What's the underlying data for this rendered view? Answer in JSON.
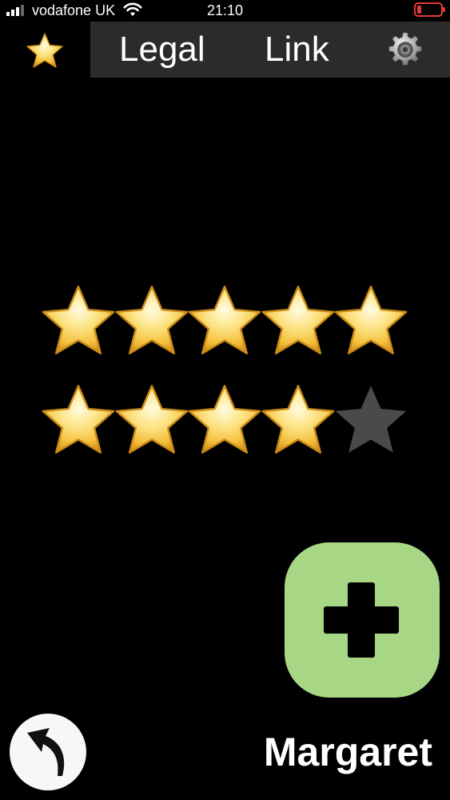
{
  "status_bar": {
    "carrier": "vodafone UK",
    "time": "21:10",
    "signal_bars": 3,
    "signal_bars_total": 4,
    "battery_level": "low",
    "icons": [
      "signal-bars-icon",
      "wifi-icon",
      "battery-icon"
    ],
    "battery_color": "#e53935"
  },
  "header": {
    "app_icon": "star-icon",
    "tabs": [
      {
        "label": "Legal"
      },
      {
        "label": "Link"
      }
    ],
    "settings_icon": "gear-icon",
    "bar_color": "#2b2b2b"
  },
  "rating": {
    "rows": [
      {
        "filled": 5,
        "total": 5
      },
      {
        "filled": 4,
        "total": 5
      }
    ],
    "stars_earned": 9,
    "stars_total": 10,
    "filled_color": "#f6c744",
    "empty_color": "#4a4a4a"
  },
  "add_button": {
    "icon": "plus-icon",
    "color": "#a7d785"
  },
  "back_button": {
    "icon": "back-arrow-icon"
  },
  "user": {
    "name": "Margaret"
  }
}
